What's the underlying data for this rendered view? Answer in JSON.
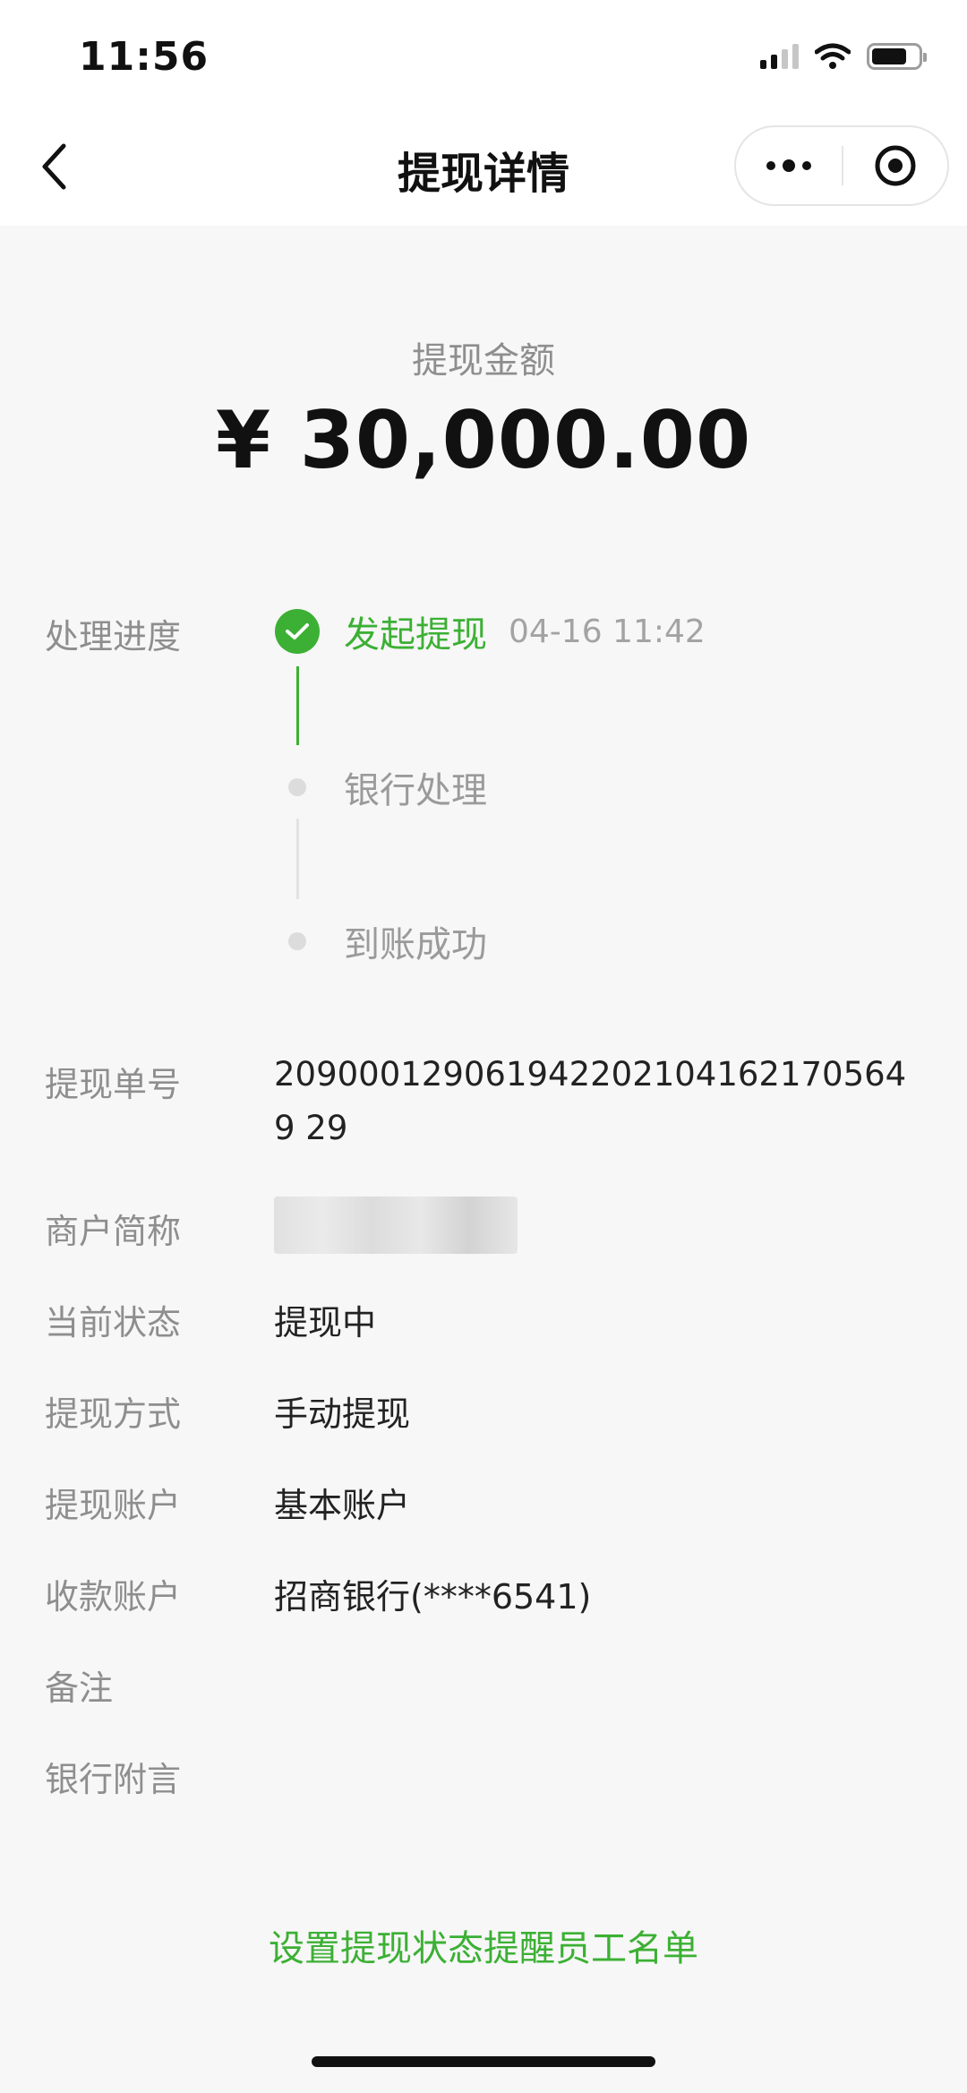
{
  "status_bar": {
    "time": "11:56"
  },
  "nav": {
    "title": "提现详情"
  },
  "amount": {
    "label": "提现金额",
    "value": "¥ 30,000.00"
  },
  "progress": {
    "label": "处理进度",
    "steps": [
      {
        "title": "发起提现",
        "time": "04-16 11:42",
        "status": "done"
      },
      {
        "title": "银行处理",
        "time": "",
        "status": "pending"
      },
      {
        "title": "到账成功",
        "time": "",
        "status": "pending"
      }
    ]
  },
  "details": {
    "order_no": {
      "label": "提现单号",
      "value": "2090001290619422021041621705649 29"
    },
    "merchant": {
      "label": "商户简称"
    },
    "current_status": {
      "label": "当前状态",
      "value": "提现中"
    },
    "method": {
      "label": "提现方式",
      "value": "手动提现"
    },
    "account": {
      "label": "提现账户",
      "value": "基本账户"
    },
    "receiving_account": {
      "label": "收款账户",
      "value": "招商银行(****6541)"
    },
    "remark": {
      "label": "备注"
    },
    "bank_note": {
      "label": "银行附言"
    }
  },
  "footer": {
    "link": "设置提现状态提醒员工名单"
  },
  "colors": {
    "accent": "#3cb034",
    "label_grey": "#8e8e8e",
    "background": "#f7f7f7"
  }
}
